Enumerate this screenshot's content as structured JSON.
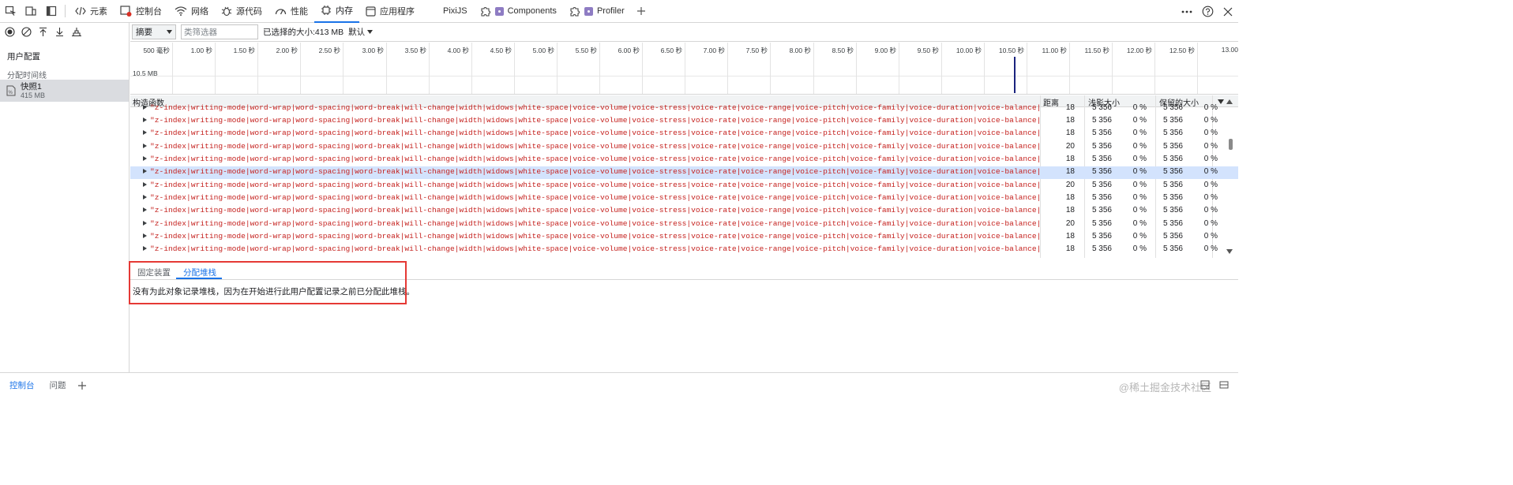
{
  "top_tabs": [
    {
      "label": "元素",
      "icon": "code-icon"
    },
    {
      "label": "控制台",
      "icon": "console-icon"
    },
    {
      "label": "网络",
      "icon": "wifi-icon"
    },
    {
      "label": "源代码",
      "icon": "bug-icon"
    },
    {
      "label": "性能",
      "icon": "gauge-icon"
    },
    {
      "label": "内存",
      "icon": "chip-icon",
      "active": true
    },
    {
      "label": "应用程序",
      "icon": "window-icon"
    },
    {
      "label": "PixiJS",
      "icon": ""
    },
    {
      "label": "Components",
      "icon": "puzzle-icon"
    },
    {
      "label": "Profiler",
      "icon": "puzzle-icon"
    }
  ],
  "left_panel": {
    "heading": "用户配置",
    "subheading": "分配时间线",
    "snapshot": {
      "name": "快照1",
      "size": "415 MB"
    }
  },
  "toolbar": {
    "view_select": "摘要",
    "filter_placeholder": "类筛选器",
    "selected_size": "已选择的大小:413 MB",
    "default_select": "默认"
  },
  "timeline": {
    "ticks": [
      "500 毫秒",
      "1.00 秒",
      "1.50 秒",
      "2.00 秒",
      "2.50 秒",
      "3.00 秒",
      "3.50 秒",
      "4.00 秒",
      "4.50 秒",
      "5.00 秒",
      "5.50 秒",
      "6.00 秒",
      "6.50 秒",
      "7.00 秒",
      "7.50 秒",
      "8.00 秒",
      "8.50 秒",
      "9.00 秒",
      "9.50 秒",
      "10.00 秒",
      "10.50 秒",
      "11.00 秒",
      "11.50 秒",
      "12.00 秒",
      "12.50 秒",
      "13.00"
    ],
    "mb_label": "10.5 MB"
  },
  "table": {
    "headers": {
      "constructor": "构造函数",
      "distance": "距离",
      "shallow": "浅影大小",
      "retained": "保留的大小"
    },
    "row_text": "\"z-index|writing-mode|word-wrap|word-spacing|word-break|will-change|width|widows|white-space|voice-volume|voice-stress|voice-rate|voice-range|voice-pitch|voice-family|voice-duration|voice-balance|visibility|ve",
    "rows": [
      {
        "distance": "18",
        "shallow": "5 356",
        "shallow_pct": "0 %",
        "retained": "5 356",
        "retained_pct": "0 %"
      },
      {
        "distance": "18",
        "shallow": "5 356",
        "shallow_pct": "0 %",
        "retained": "5 356",
        "retained_pct": "0 %"
      },
      {
        "distance": "18",
        "shallow": "5 356",
        "shallow_pct": "0 %",
        "retained": "5 356",
        "retained_pct": "0 %"
      },
      {
        "distance": "20",
        "shallow": "5 356",
        "shallow_pct": "0 %",
        "retained": "5 356",
        "retained_pct": "0 %"
      },
      {
        "distance": "18",
        "shallow": "5 356",
        "shallow_pct": "0 %",
        "retained": "5 356",
        "retained_pct": "0 %"
      },
      {
        "distance": "18",
        "shallow": "5 356",
        "shallow_pct": "0 %",
        "retained": "5 356",
        "retained_pct": "0 %",
        "selected": true
      },
      {
        "distance": "20",
        "shallow": "5 356",
        "shallow_pct": "0 %",
        "retained": "5 356",
        "retained_pct": "0 %"
      },
      {
        "distance": "18",
        "shallow": "5 356",
        "shallow_pct": "0 %",
        "retained": "5 356",
        "retained_pct": "0 %"
      },
      {
        "distance": "18",
        "shallow": "5 356",
        "shallow_pct": "0 %",
        "retained": "5 356",
        "retained_pct": "0 %"
      },
      {
        "distance": "20",
        "shallow": "5 356",
        "shallow_pct": "0 %",
        "retained": "5 356",
        "retained_pct": "0 %"
      },
      {
        "distance": "18",
        "shallow": "5 356",
        "shallow_pct": "0 %",
        "retained": "5 356",
        "retained_pct": "0 %"
      },
      {
        "distance": "18",
        "shallow": "5 356",
        "shallow_pct": "0 %",
        "retained": "5 356",
        "retained_pct": "0 %"
      }
    ]
  },
  "detail": {
    "tabs": [
      {
        "label": "固定装置"
      },
      {
        "label": "分配堆栈",
        "active": true
      }
    ],
    "message": "没有为此对象记录堆栈，因为在开始进行此用户配置记录之前已分配此堆栈。"
  },
  "drawer": {
    "tabs": [
      {
        "label": "控制台",
        "active": true
      },
      {
        "label": "问题"
      }
    ],
    "watermark": "@稀土掘金技术社区"
  },
  "colors": {
    "accent": "#1a73e8",
    "string_red": "#c5221f",
    "selected_row": "#d3e3fd",
    "highlight_box": "#e53935"
  }
}
